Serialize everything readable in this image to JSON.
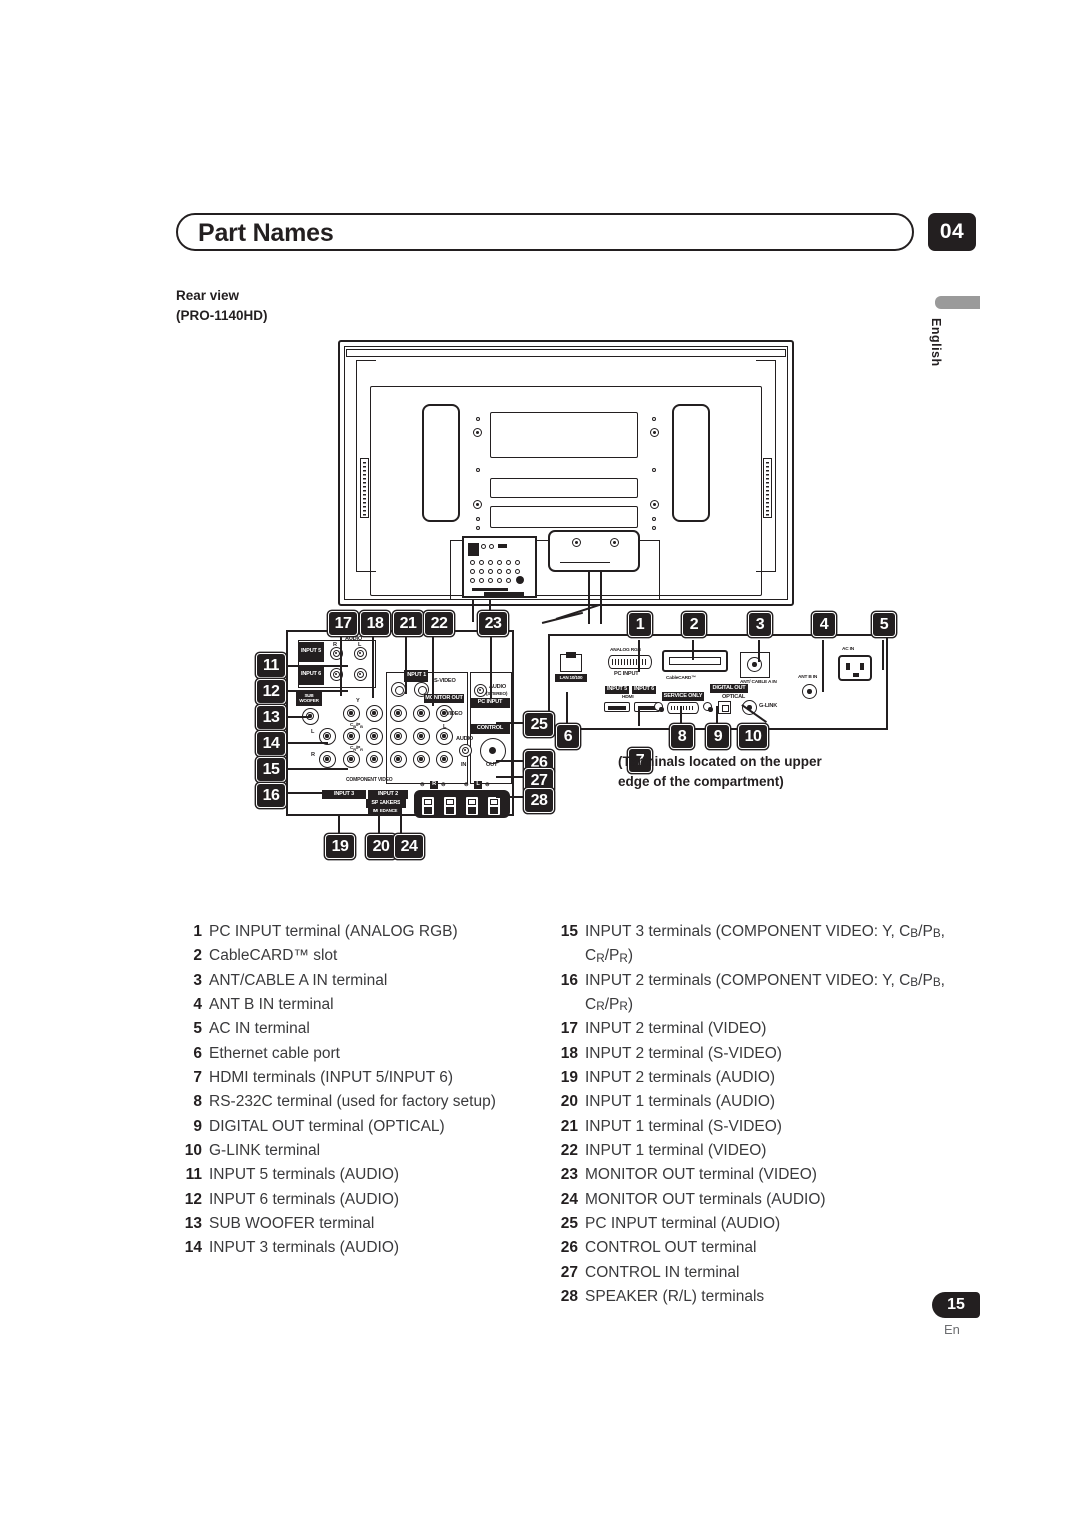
{
  "header": {
    "title": "Part Names",
    "chapter": "04"
  },
  "side_tab": {
    "language": "English"
  },
  "subtitle": {
    "line1": "Rear view",
    "line2": "(PRO-1140HD)"
  },
  "figure": {
    "caption_line1": "(Terminals located on the upper",
    "caption_line2": "edge of the compartment)",
    "left_panel_labels": {
      "input5": "INPUT 5",
      "input6": "INPUT 6",
      "audio": "AUDIO",
      "r": "R",
      "l": "L",
      "sub_woofer": "SUB WOOFER",
      "y": "Y",
      "cb_pb": "CB/PB",
      "cr_pr": "CR/PR",
      "component_video": "COMPONENT VIDEO",
      "input3": "INPUT 3",
      "input2": "INPUT 2",
      "input1": "INPUT 1",
      "s_video": "S-VIDEO",
      "video": "VIDEO",
      "monitor_out": "MONITOR OUT",
      "pc_input": "PC INPUT",
      "audio_stereo": "(STEREO)",
      "control": "CONTROL",
      "in": "IN",
      "out": "OUT",
      "speakers": "SPEAKERS",
      "impedance": "IMPEDANCE"
    },
    "right_panel_labels": {
      "analog_rgb": "ANALOG RGB",
      "pc_input": "PC INPUT",
      "cablecard": "CableCARD™",
      "ant_cable_a_in": "ANT/ CABLE A IN",
      "ant_b_in": "ANT B IN",
      "ac_in": "AC IN",
      "lan": "LAN 10/100",
      "input5": "INPUT 5",
      "input6": "INPUT 6",
      "hdmi": "HDMI",
      "service_only": "SERVICE ONLY",
      "digital_out": "DIGITAL OUT",
      "optical": "OPTICAL",
      "g_link": "G-LINK"
    },
    "callouts": [
      "1",
      "2",
      "3",
      "4",
      "5",
      "6",
      "7",
      "8",
      "9",
      "10",
      "11",
      "12",
      "13",
      "14",
      "15",
      "16",
      "17",
      "18",
      "19",
      "20",
      "21",
      "22",
      "23",
      "24",
      "25",
      "26",
      "27",
      "28"
    ]
  },
  "parts_left": [
    {
      "num": "1",
      "text": "PC INPUT terminal (ANALOG RGB)"
    },
    {
      "num": "2",
      "text": "CableCARD™ slot"
    },
    {
      "num": "3",
      "text": "ANT/CABLE A IN terminal"
    },
    {
      "num": "4",
      "text": "ANT B IN terminal"
    },
    {
      "num": "5",
      "text": "AC IN terminal"
    },
    {
      "num": "6",
      "text": "Ethernet cable port"
    },
    {
      "num": "7",
      "text": "HDMI terminals (INPUT 5/INPUT 6)"
    },
    {
      "num": "8",
      "text": "RS-232C terminal (used for factory setup)"
    },
    {
      "num": "9",
      "text": "DIGITAL OUT terminal (OPTICAL)"
    },
    {
      "num": "10",
      "text": "G-LINK terminal"
    },
    {
      "num": "11",
      "text": "INPUT 5 terminals (AUDIO)"
    },
    {
      "num": "12",
      "text": "INPUT 6 terminals (AUDIO)"
    },
    {
      "num": "13",
      "text": "SUB WOOFER terminal"
    },
    {
      "num": "14",
      "text": "INPUT 3 terminals (AUDIO)"
    }
  ],
  "parts_right": [
    {
      "num": "15",
      "text": "INPUT 3 terminals (COMPONENT VIDEO: Y, CB/PB, CR/PR)"
    },
    {
      "num": "16",
      "text": "INPUT 2 terminals (COMPONENT VIDEO: Y, CB/PB, CR/PR)"
    },
    {
      "num": "17",
      "text": "INPUT 2 terminal (VIDEO)"
    },
    {
      "num": "18",
      "text": "INPUT 2 terminal (S-VIDEO)"
    },
    {
      "num": "19",
      "text": "INPUT 2 terminals (AUDIO)"
    },
    {
      "num": "20",
      "text": "INPUT 1 terminals (AUDIO)"
    },
    {
      "num": "21",
      "text": "INPUT 1 terminal (S-VIDEO)"
    },
    {
      "num": "22",
      "text": "INPUT 1 terminal (VIDEO)"
    },
    {
      "num": "23",
      "text": "MONITOR OUT terminal (VIDEO)"
    },
    {
      "num": "24",
      "text": "MONITOR OUT terminals (AUDIO)"
    },
    {
      "num": "25",
      "text": "PC INPUT terminal (AUDIO)"
    },
    {
      "num": "26",
      "text": "CONTROL OUT terminal"
    },
    {
      "num": "27",
      "text": "CONTROL IN terminal"
    },
    {
      "num": "28",
      "text": "SPEAKER (R/L) terminals"
    }
  ],
  "footer": {
    "page_number": "15",
    "language_code": "En"
  }
}
